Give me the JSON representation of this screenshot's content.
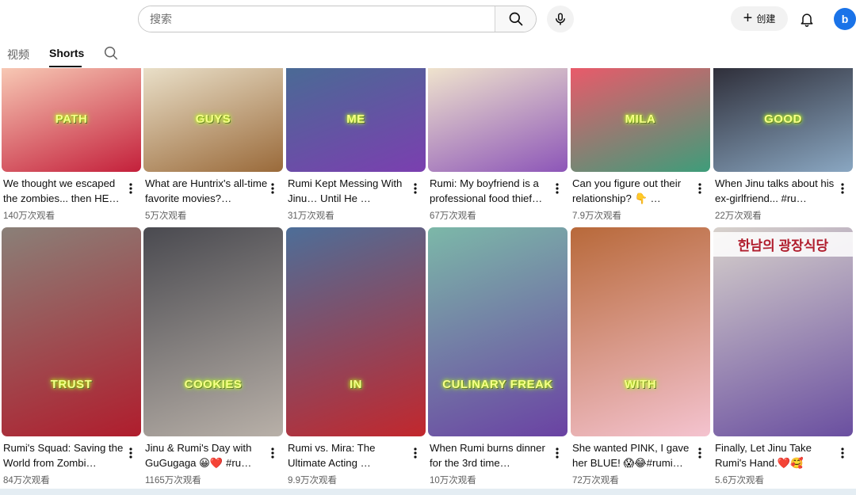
{
  "header": {
    "search_placeholder": "搜索",
    "create_label": "创建",
    "avatar_letter": "b"
  },
  "tabs": [
    {
      "label": "视频",
      "active": false
    },
    {
      "label": "Shorts",
      "active": true
    }
  ],
  "shorts": [
    {
      "title": "We thought we escaped the zombies... then HE…",
      "views": "140万次观看",
      "caption": "PATH",
      "gradient": [
        "#f7c8b4",
        "#c4203b"
      ]
    },
    {
      "title": "What are Huntrix's all-time favorite movies?…",
      "views": "5万次观看",
      "caption": "GUYS",
      "gradient": [
        "#e9dfc8",
        "#9a6a3a"
      ]
    },
    {
      "title": "Rumi Kept Messing With Jinu… Until He …",
      "views": "31万次观看",
      "caption": "ME",
      "gradient": [
        "#4a6a95",
        "#7b3fb0"
      ]
    },
    {
      "title": "Rumi: My boyfriend is a professional food thief…",
      "views": "67万次观看",
      "caption": "",
      "gradient": [
        "#efe3cd",
        "#8d56b8"
      ]
    },
    {
      "title": "Can you figure out their relationship? 👇 …",
      "views": "7.9万次观看",
      "caption": "MILA",
      "gradient": [
        "#e95a6a",
        "#3e9d7a"
      ]
    },
    {
      "title": "When Jinu talks about his ex-girlfriend... #ru…",
      "views": "22万次观看",
      "caption": "GOOD",
      "gradient": [
        "#2f2f3a",
        "#8aa7c2"
      ]
    },
    {
      "title": "Rumi's Squad: Saving the World from Zombi…",
      "views": "84万次观看",
      "caption": "TRUST",
      "gradient": [
        "#8a8078",
        "#b01d2d"
      ]
    },
    {
      "title": "Jinu & Rumi's Day with GuGugaga 😀❤️ #ru…",
      "views": "1165万次观看",
      "caption": "COOKIES",
      "gradient": [
        "#4a4a50",
        "#b8b0a8"
      ]
    },
    {
      "title": "Rumi vs. Mira: The Ultimate Acting …",
      "views": "9.9万次观看",
      "caption": "IN",
      "gradient": [
        "#4d6e98",
        "#c2272d"
      ]
    },
    {
      "title": "When Rumi burns dinner for the 3rd time…",
      "views": "10万次观看",
      "caption": "CULINARY FREAK",
      "gradient": [
        "#7cb8a8",
        "#6a42a3"
      ]
    },
    {
      "title": "She wanted PINK, I gave her BLUE! 😱😂#rumi…",
      "views": "72万次观看",
      "caption": "WITH",
      "gradient": [
        "#b8693a",
        "#f4c3cf"
      ]
    },
    {
      "title": "Finally, Let Jinu Take Rumi's Hand.❤️🥰",
      "views": "5.6万次观看",
      "caption": "",
      "gradient": [
        "#d8d2cc",
        "#6a4fa0"
      ]
    }
  ],
  "shop_sign": "한남의 광장식당"
}
